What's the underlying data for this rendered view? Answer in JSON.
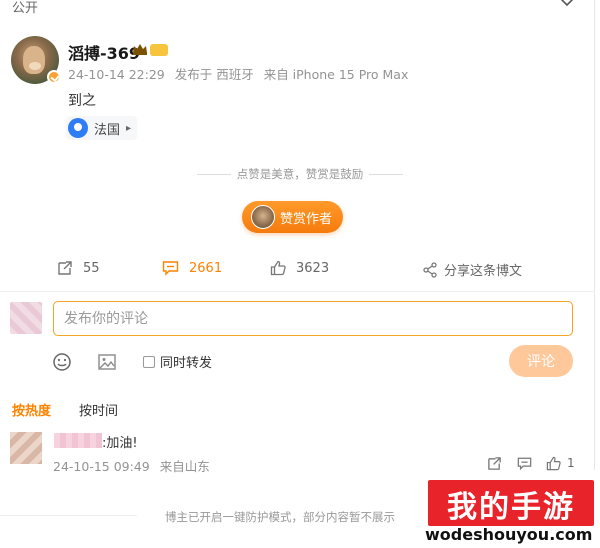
{
  "header": {
    "visibility_label": "公开"
  },
  "post": {
    "username": "滔搏-369",
    "level_badge": "",
    "time": "24-10-14 22:29",
    "posted_from": "发布于 西班牙",
    "device": "来自 iPhone 15 Pro Max",
    "content": "到之",
    "location": "法国"
  },
  "reward": {
    "hint": "点赞是美意，赞赏是鼓励",
    "button_label": "赞赏作者"
  },
  "actions": {
    "forward_count": "55",
    "comment_count": "2661",
    "like_count": "3623",
    "share_label": "分享这条博文"
  },
  "composer": {
    "placeholder": "发布你的评论",
    "also_forward_label": "同时转发",
    "submit_label": "评论"
  },
  "sort": {
    "hot_label": "按热度",
    "time_label": "按时间"
  },
  "comments": [
    {
      "text": ":加油!",
      "time": "24-10-15 09:49",
      "source": "来自山东",
      "likes": "1"
    }
  ],
  "footer": {
    "notice": "博主已开启一键防护模式，部分内容暂不展示"
  },
  "watermark": {
    "title": "我的手游",
    "url": "wodeshouyou.com"
  },
  "colors": {
    "accent": "#ff8200",
    "input_border": "#f5a623",
    "submit_disabled": "#ffc89b",
    "watermark": "#e8232a"
  }
}
